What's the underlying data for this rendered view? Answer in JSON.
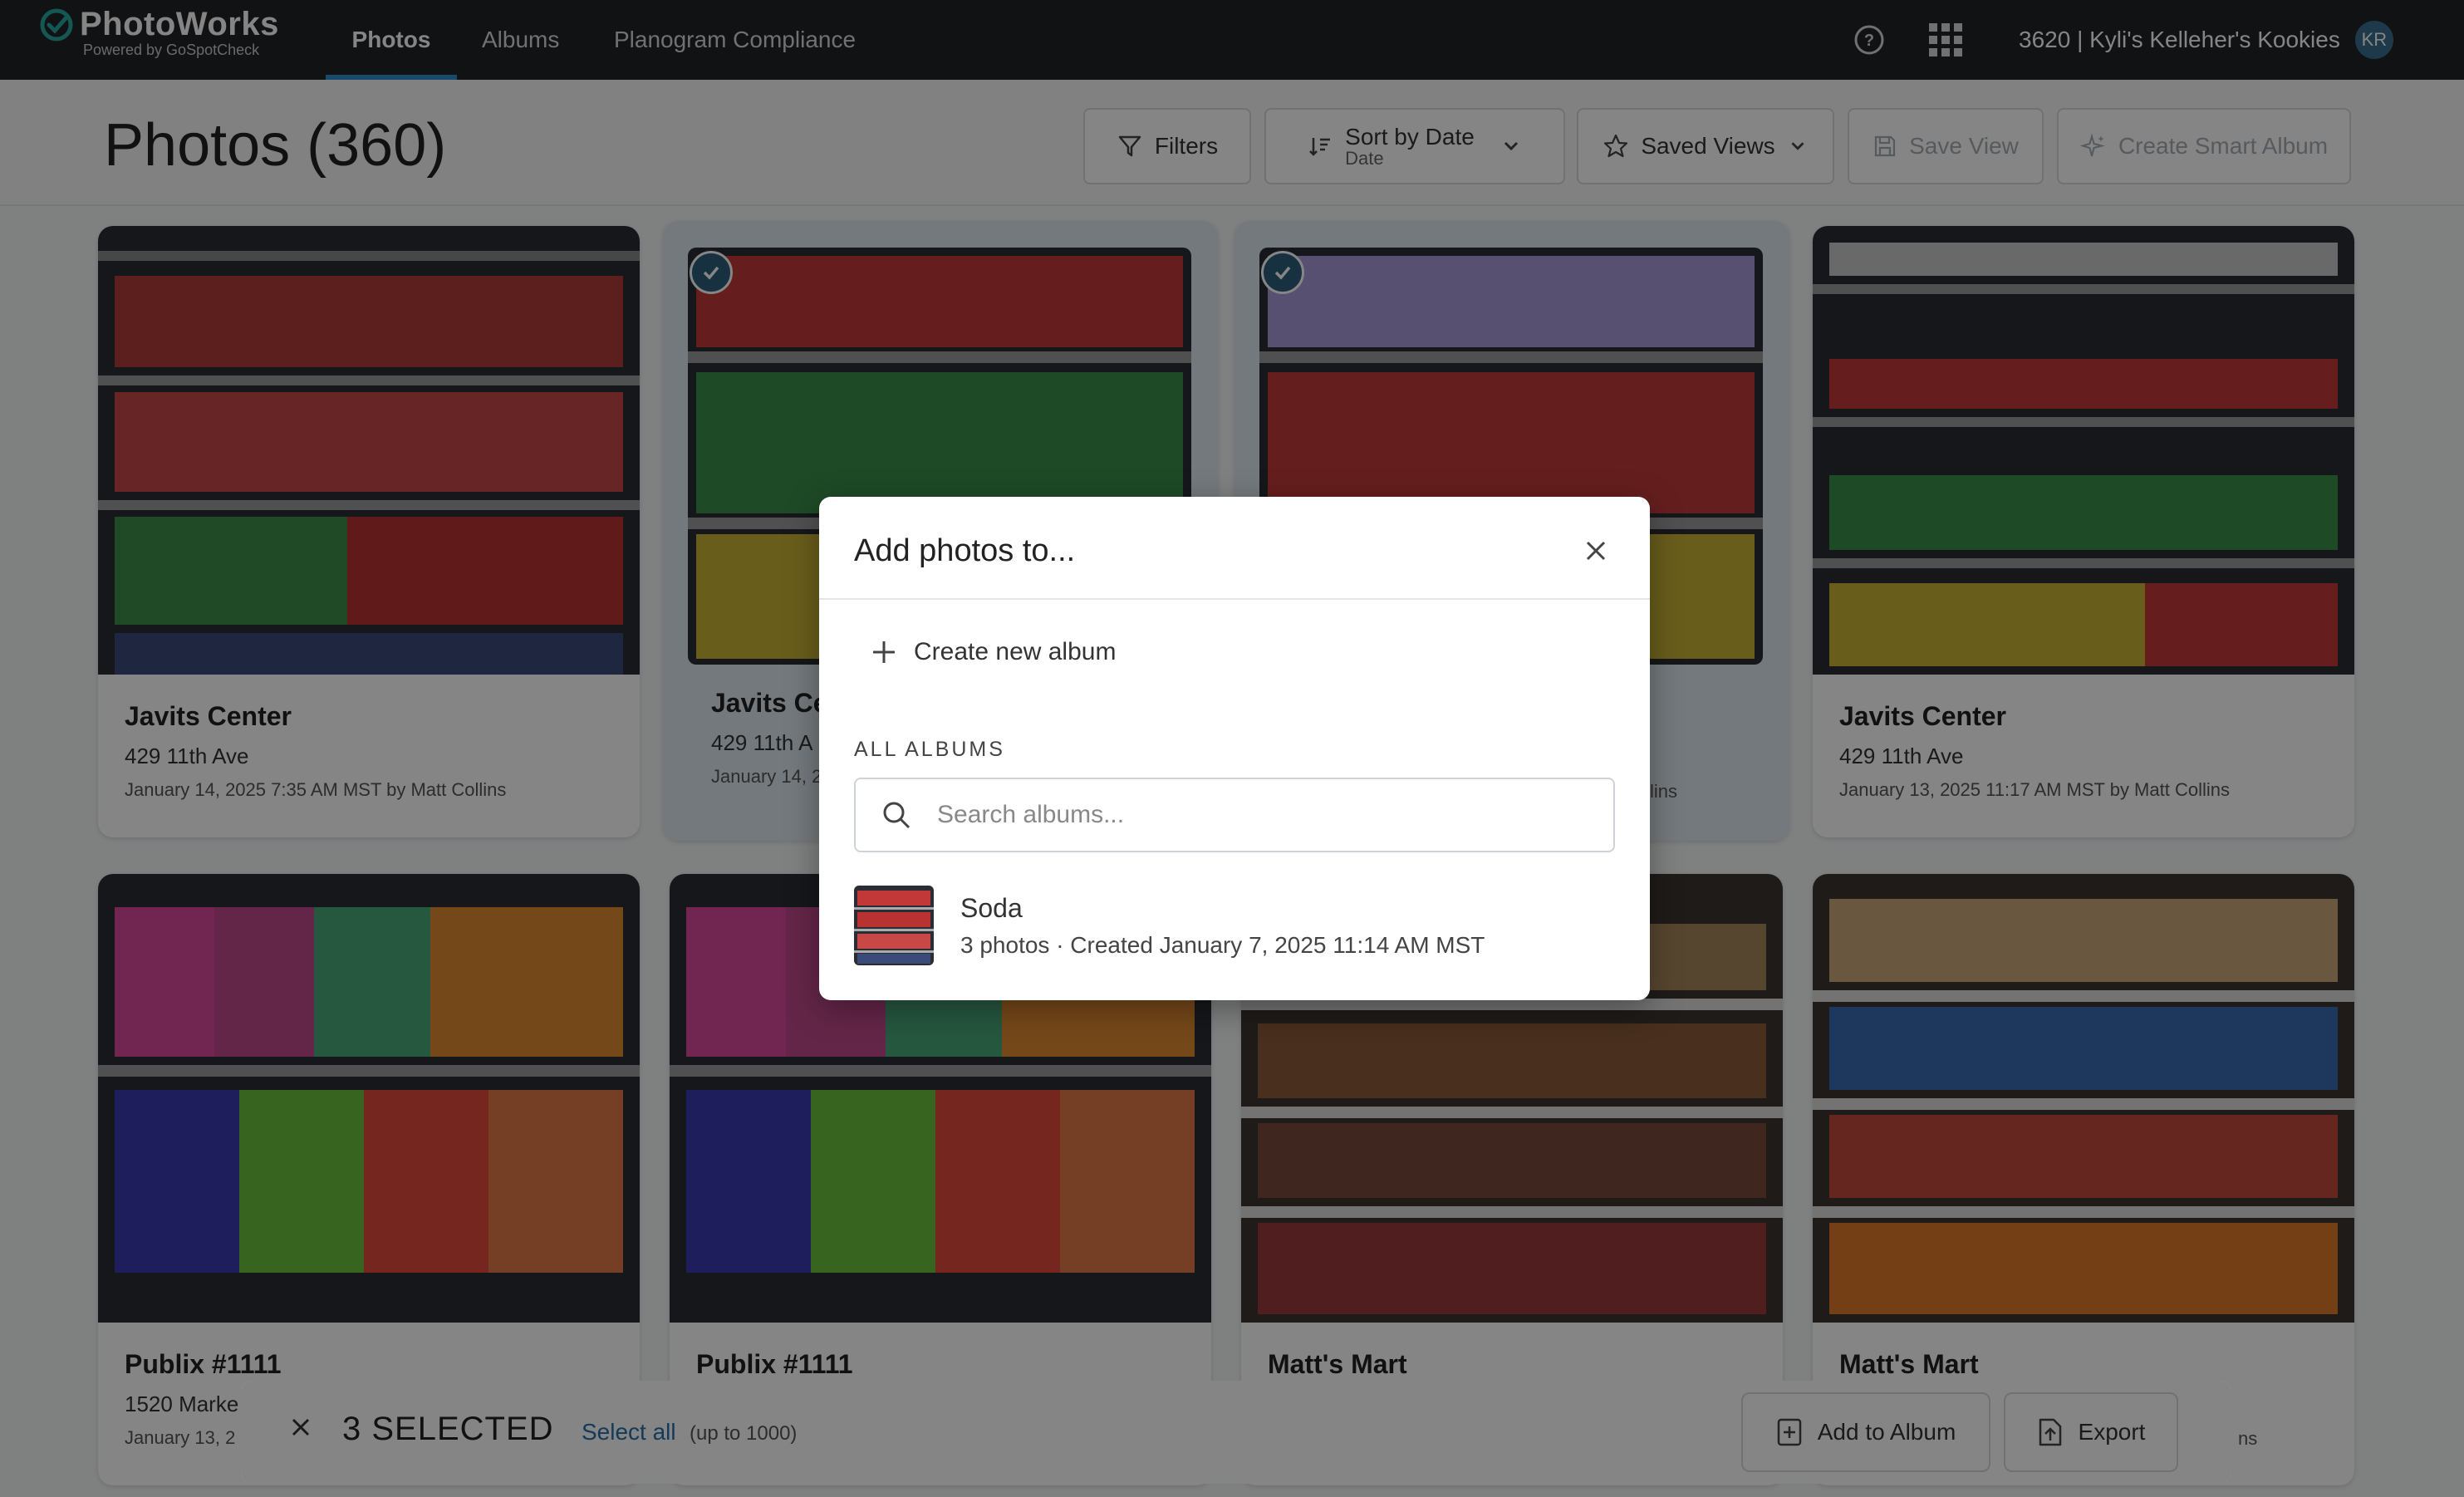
{
  "app": {
    "name": "PhotoWorks",
    "tagline": "Powered by GoSpotCheck",
    "brand_color": "#2f8fd0"
  },
  "nav": {
    "tabs": [
      {
        "label": "Photos",
        "active": true
      },
      {
        "label": "Albums",
        "active": false
      },
      {
        "label": "Planogram Compliance",
        "active": false
      }
    ],
    "account": "3620 | Kyli's Kelleher's Kookies",
    "avatar_initials": "KR",
    "help_icon": "help-circle-icon",
    "apps_icon": "apps-grid-icon"
  },
  "header": {
    "title": "Photos (360)",
    "filters_label": "Filters",
    "sort_label": "Sort by Date",
    "sort_value": "Date",
    "saved_views_label": "Saved Views",
    "save_view_label": "Save View",
    "create_smart_album_label": "Create Smart Album"
  },
  "photos": [
    {
      "title": "Javits Center",
      "address": "429 11th Ave",
      "date": "January 14, 2025 7:35 AM MST by Matt Collins",
      "selected": false
    },
    {
      "title": "Javits Ce",
      "address": "429 11th A",
      "date": "January 14, 2",
      "selected": true
    },
    {
      "title": "",
      "address": "",
      "date": "lins",
      "selected": true
    },
    {
      "title": "Javits Center",
      "address": "429 11th Ave",
      "date": "January 13, 2025 11:17 AM MST by Matt Collins",
      "selected": false
    },
    {
      "title": "Publix #1111",
      "address": "1520 Marke",
      "date": "January 13, 2",
      "selected": false
    },
    {
      "title": "Publix #1111",
      "address": "",
      "date": "",
      "selected": false
    },
    {
      "title": "Matt's Mart",
      "address": "",
      "date": "",
      "selected": false
    },
    {
      "title": "Matt's Mart",
      "address": "",
      "date": "ns",
      "selected": false
    }
  ],
  "selection_bar": {
    "count_label": "3 SELECTED",
    "select_all_label": "Select all",
    "limit_label": "(up to 1000)",
    "add_to_album_label": "Add to Album",
    "export_label": "Export"
  },
  "modal": {
    "title": "Add photos to...",
    "create_label": "Create new album",
    "albums_heading": "ALL ALBUMS",
    "search_placeholder": "Search albums...",
    "albums": [
      {
        "name": "Soda",
        "meta": "3 photos · Created January 7, 2025 11:14 AM MST"
      }
    ]
  }
}
